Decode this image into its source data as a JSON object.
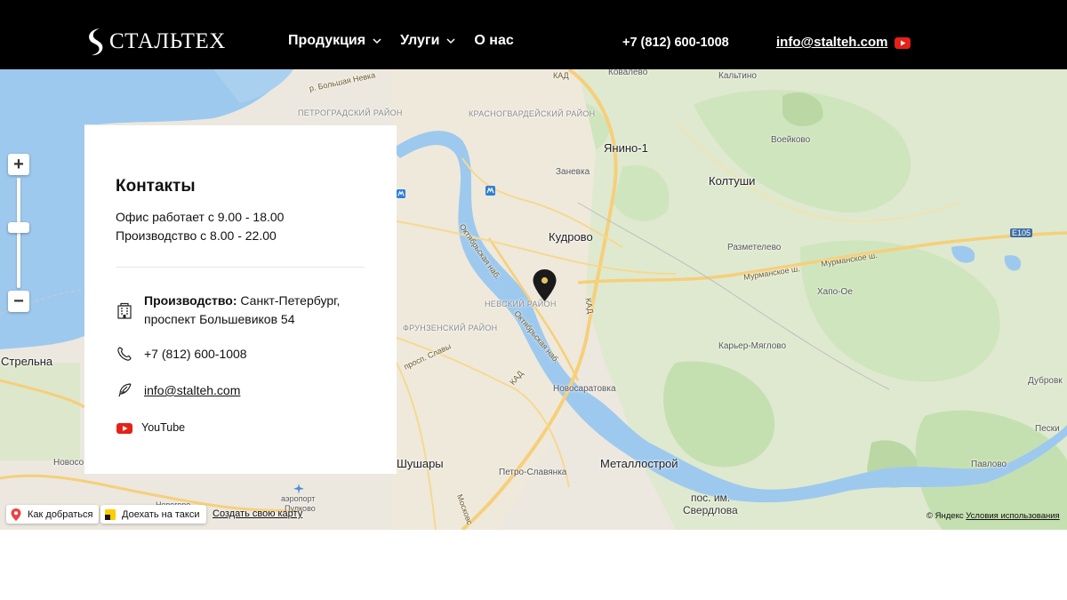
{
  "header": {
    "logo_text": "СТАЛЬТЕХ",
    "nav": [
      {
        "label": "Продукция",
        "has_dropdown": true
      },
      {
        "label": "Улуги",
        "has_dropdown": true
      },
      {
        "label": "О нас",
        "has_dropdown": false
      }
    ],
    "phone": "+7 (812) 600-1008",
    "email": "info@stalteh.com",
    "youtube_icon": "youtube-icon"
  },
  "contacts": {
    "title": "Контакты",
    "hours_office": "Офис работает с 9.00 - 18.00",
    "hours_production": "Производство с 8.00 - 22.00",
    "address_label": "Производство:",
    "address_value": "Санкт-Петербург, проспект Большевиков 54",
    "phone": "+7 (812) 600-1008",
    "email": "info@stalteh.com",
    "youtube": "YouTube",
    "icons": [
      "building-icon",
      "phone-icon",
      "feather-icon",
      "youtube-icon"
    ]
  },
  "map": {
    "labels": {
      "kovalevo": "Ковалево",
      "kaltino": "Кальтино",
      "kad_top": "КАД",
      "kudrovo_top": "КУДРОВО",
      "yanino": "Янино-1",
      "voeykovo": "Воейково",
      "zanevka": "Заневка",
      "koltushi": "Колтуши",
      "kudrovo": "Кудрово",
      "e105": "E105",
      "razmetelevo": "Разметелево",
      "murm1": "Мурманское ш.",
      "murm2": "Мурманское ш.",
      "khapo": "Хапо-Ое",
      "nevsky": "НЕВСКИЙ РАЙОН",
      "kad_mid": "КАД",
      "frunz": "ФРУНЗЕНСКИЙ РАЙОН",
      "oktyab1": "Октябрьская наб.",
      "oktyab2": "Октябрьская наб.",
      "karier": "Карьер-Мяглово",
      "dubrov": "Дубровк",
      "strelna": "Стрельна",
      "slavy": "просп. Славы",
      "kad_low": "КАД",
      "novosar": "Новосаратовка",
      "peski": "Пески",
      "shushary": "Шушары",
      "novoso": "Новосо",
      "metallo": "Металлострой",
      "pavlovo": "Павлово",
      "petro": "Петро-Славянка",
      "pos": "пос. им.",
      "sverdlova": "Свердлова",
      "airport": "аэропорт",
      "pulkovo": "Пулково",
      "moskov": "Московс",
      "krasnogv": "КРАСНОГВАРДЕЙСКИЙ РАЙОН",
      "petrograd": "ПЕТРОГРАДСКИЙ РАЙОН",
      "bnevka": "р. Большая Невка",
      "novogoro": "Новогоро"
    },
    "route_button": "Как добраться",
    "taxi_button": "Доехать на такси",
    "create_map": "Создать свою карту",
    "copyright": "© Яндекс",
    "terms": "Условия использования",
    "colors": {
      "water": "#9ec9ee",
      "greenery": "#cfe5bd",
      "road": "#f6cf7a",
      "pin": "#1a1a1a",
      "pin_dot": "#e7c261",
      "youtube": "#e62117",
      "header_bg": "#000000"
    }
  }
}
